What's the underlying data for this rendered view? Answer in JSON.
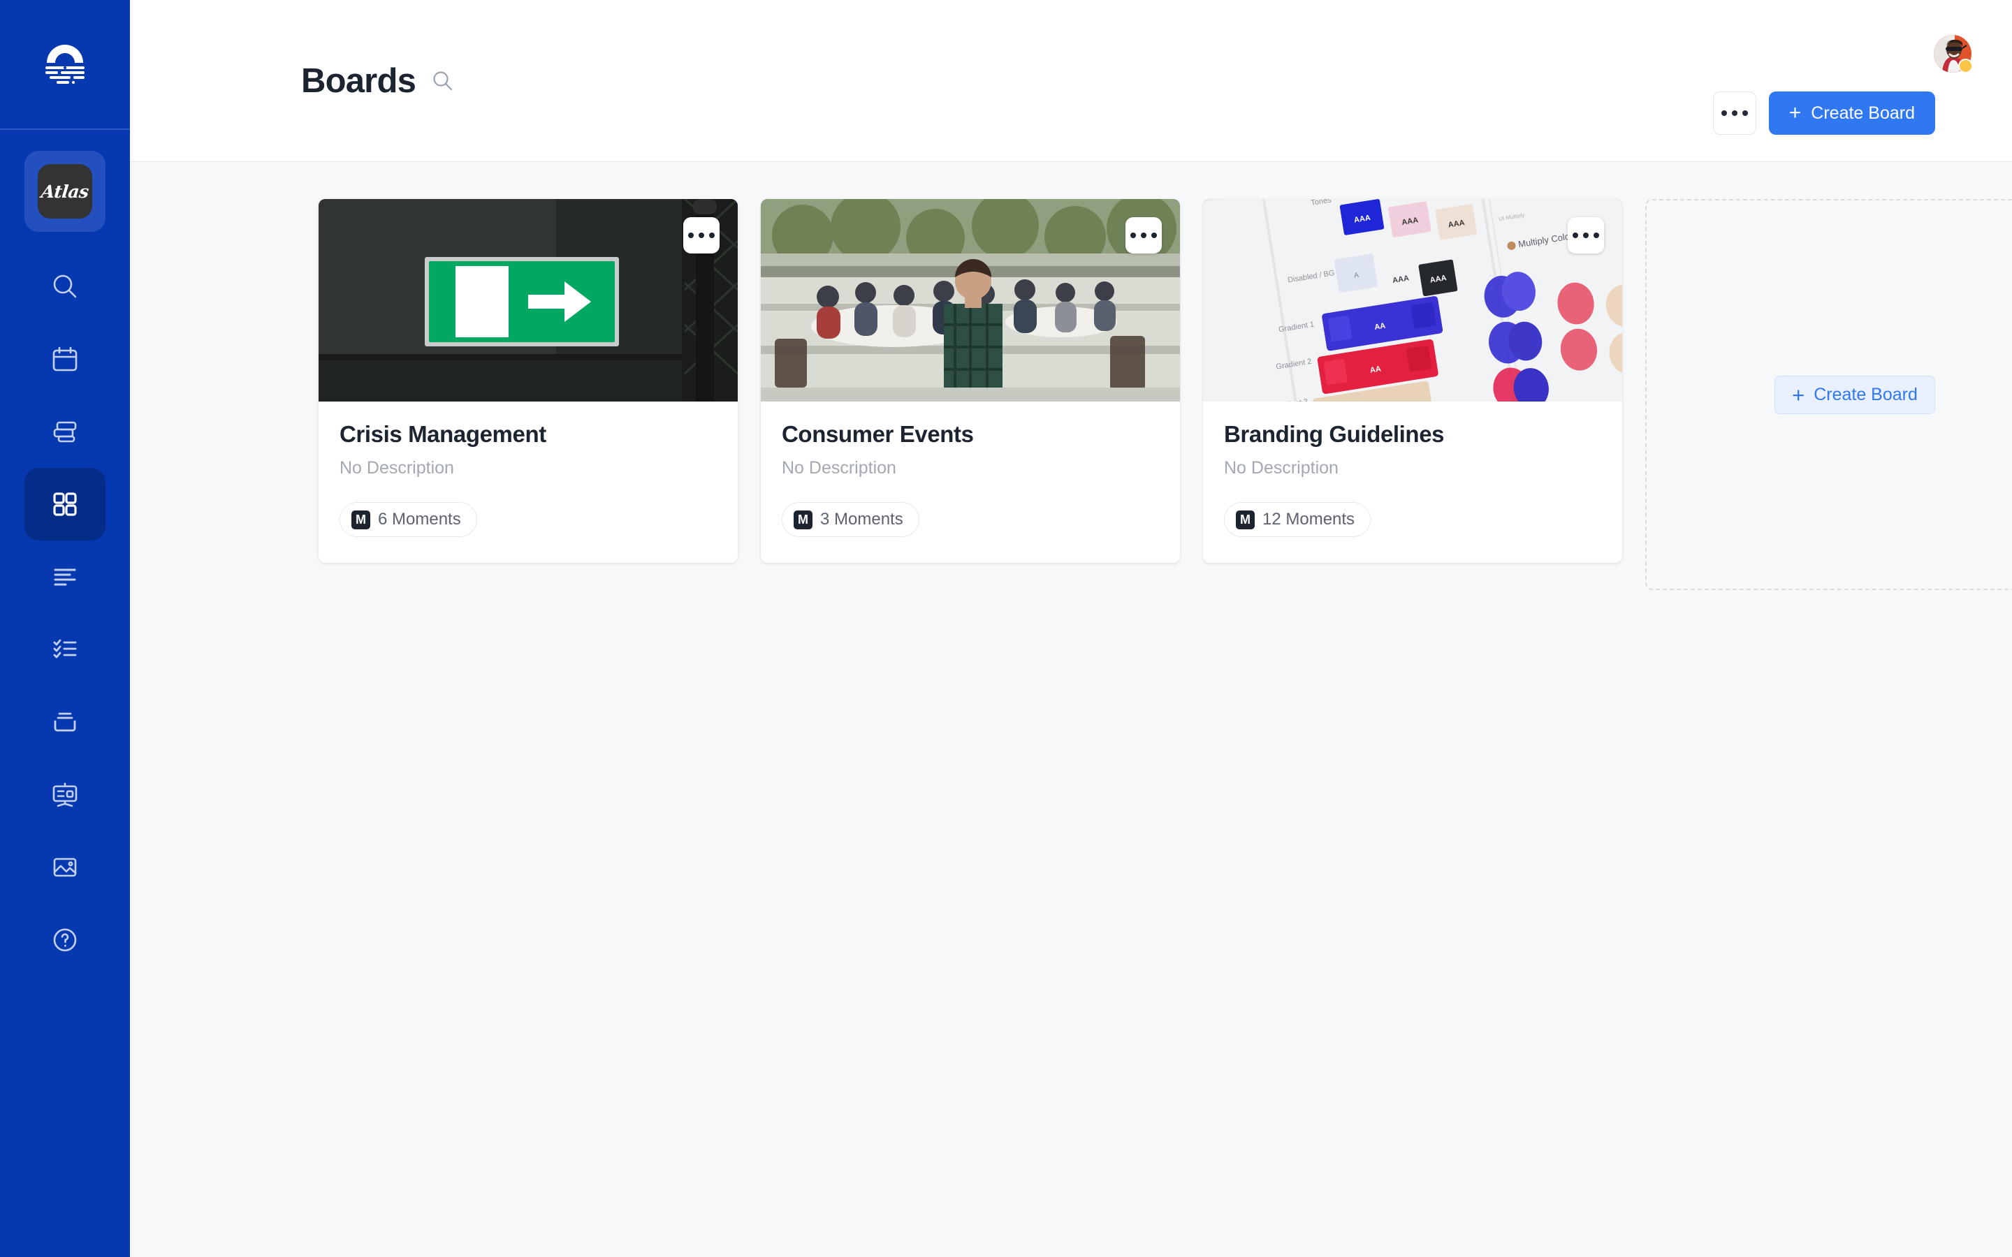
{
  "app": {
    "brand_logo_icon": "sunrise-logo-icon",
    "workspace_name": "Atlas"
  },
  "sidebar": {
    "items": [
      {
        "id": "search",
        "icon": "search-icon",
        "label": "Search",
        "active": false
      },
      {
        "id": "calendar",
        "icon": "calendar-icon",
        "label": "Calendar",
        "active": false
      },
      {
        "id": "stacks",
        "icon": "layers-icon",
        "label": "Stacks",
        "active": false
      },
      {
        "id": "boards",
        "icon": "grid-icon",
        "label": "Boards",
        "active": true
      },
      {
        "id": "stories",
        "icon": "text-lines-icon",
        "label": "Stories",
        "active": false
      },
      {
        "id": "tasks",
        "icon": "checklist-icon",
        "label": "Tasks",
        "active": false
      },
      {
        "id": "inbox",
        "icon": "inbox-icon",
        "label": "Inbox",
        "active": false
      },
      {
        "id": "presentations",
        "icon": "presentation-icon",
        "label": "Presentations",
        "active": false
      },
      {
        "id": "media",
        "icon": "image-icon",
        "label": "Media",
        "active": false
      },
      {
        "id": "help",
        "icon": "help-circle-icon",
        "label": "Help",
        "active": false
      }
    ]
  },
  "header": {
    "title": "Boards",
    "search_icon": "search-icon",
    "more_button_icon": "ellipsis-icon",
    "create_board_label": "Create Board",
    "create_board_plus": "+",
    "avatar": {
      "icon": "avatar",
      "status_color": "#fcc54a"
    }
  },
  "content": {
    "boards": [
      {
        "title": "Crisis Management",
        "description": "No Description",
        "moments_count": "6 Moments",
        "moment_icon_letter": "M",
        "menu_icon": "ellipsis-icon",
        "thumb": "exit-sign-photo"
      },
      {
        "title": "Consumer Events",
        "description": "No Description",
        "moments_count": "3 Moments",
        "moment_icon_letter": "M",
        "menu_icon": "ellipsis-icon",
        "thumb": "outdoor-event-photo"
      },
      {
        "title": "Branding Guidelines",
        "description": "No Description",
        "moments_count": "12 Moments",
        "moment_icon_letter": "M",
        "menu_icon": "ellipsis-icon",
        "thumb": "color-swatches-photo"
      }
    ],
    "create_card": {
      "label": "Create Board",
      "plus": "+"
    }
  },
  "colors": {
    "sidebar_bg": "#0639b0",
    "sidebar_active": "#042c89",
    "accent": "#3077f2",
    "accent_soft_bg": "#eaf1fe",
    "page_bg": "#f7f8fa",
    "text_primary": "#1c2430",
    "text_muted": "#a3a9b2"
  }
}
